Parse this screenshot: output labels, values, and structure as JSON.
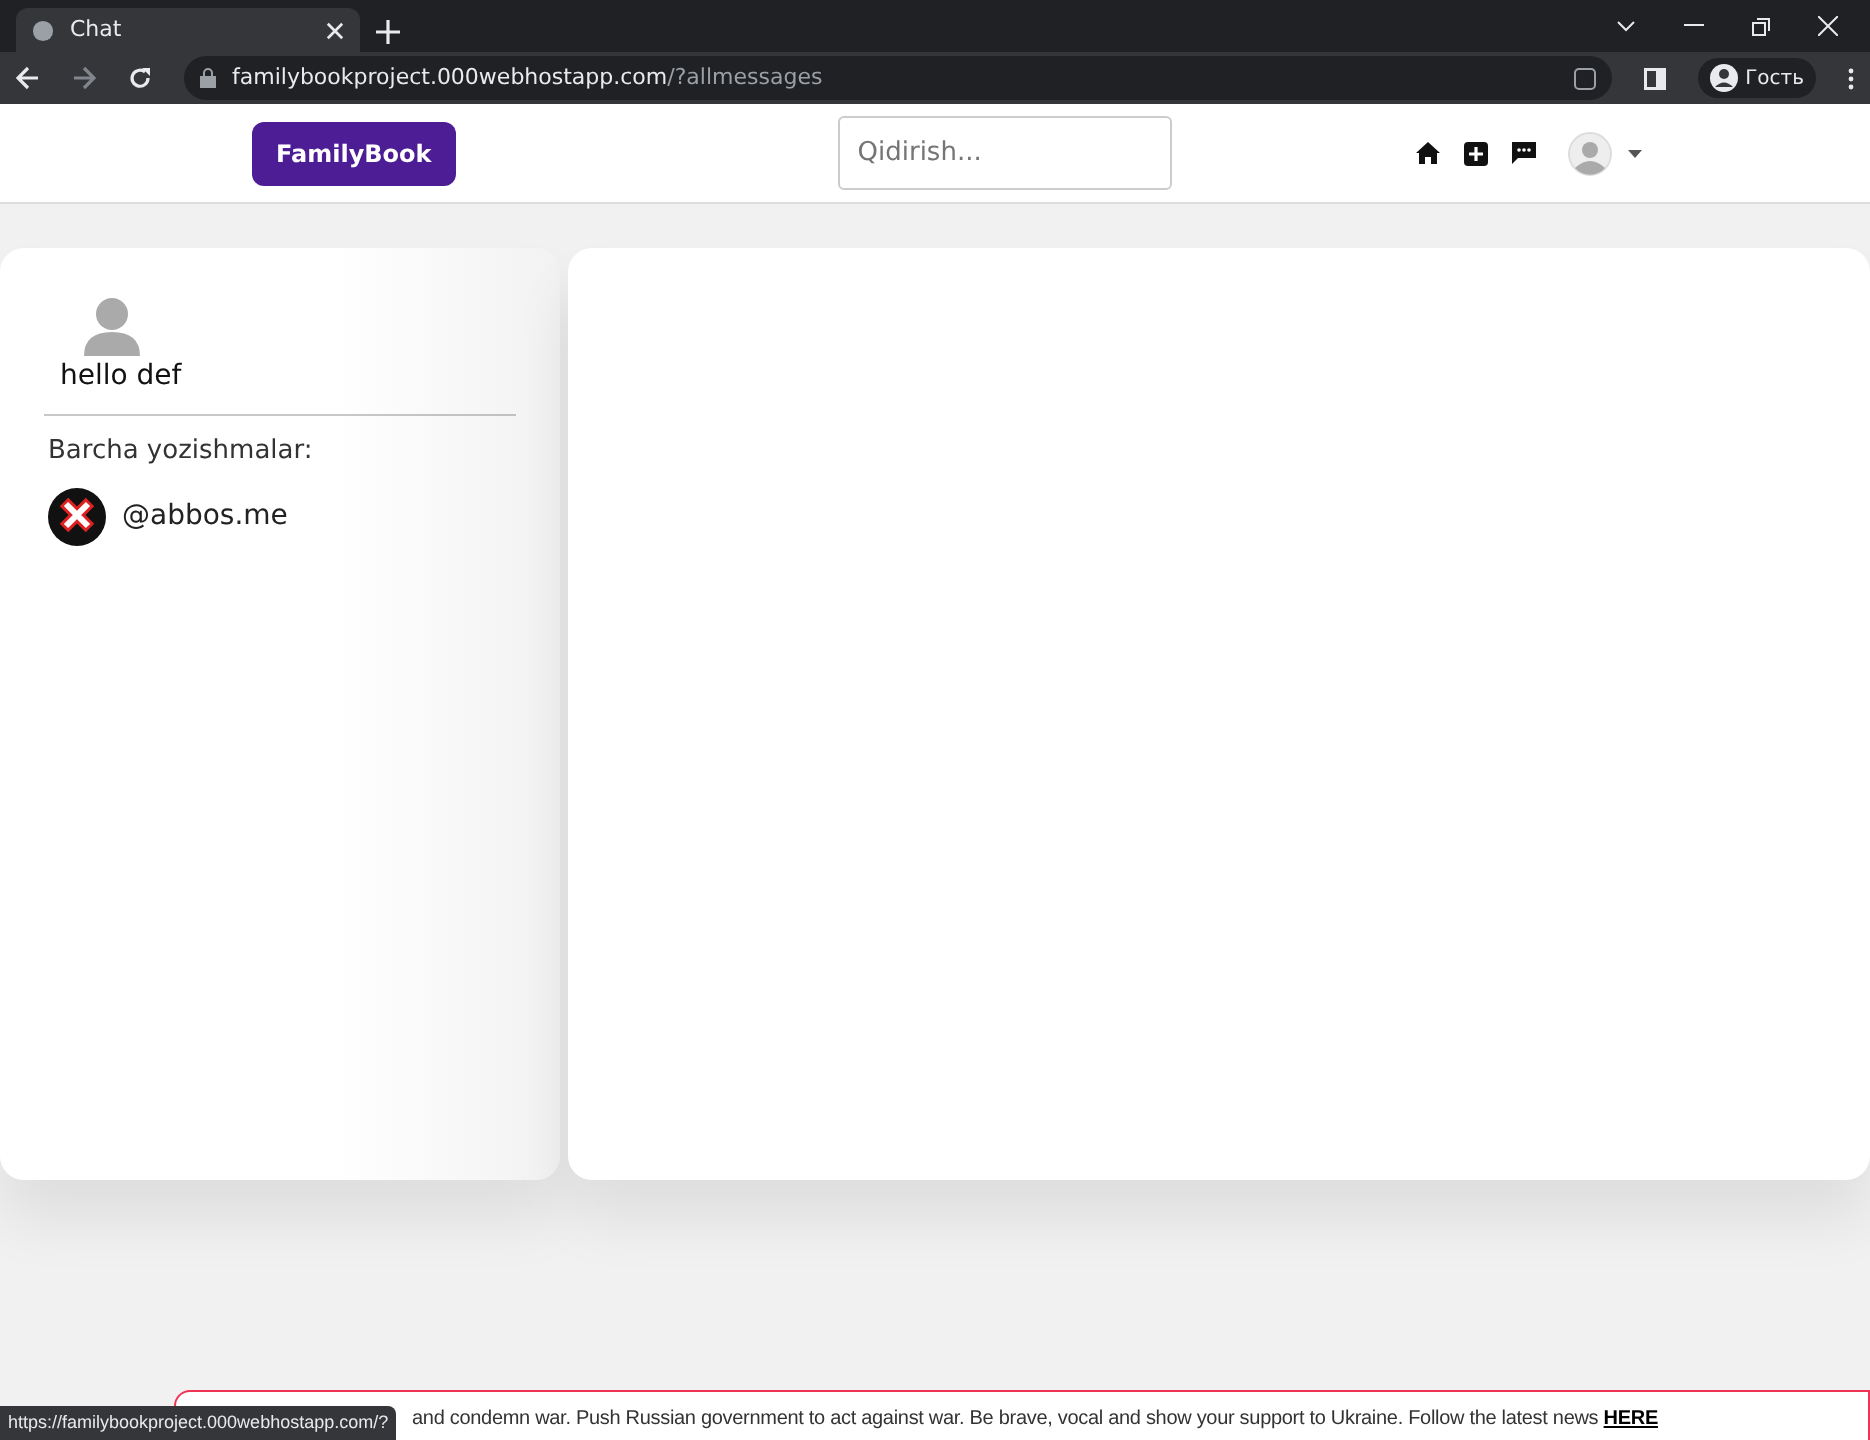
{
  "browser": {
    "tab_title": "Chat",
    "url_host": "familybookproject.000webhostapp.com",
    "url_path": "/?allmessages",
    "profile": "Гость"
  },
  "navbar": {
    "brand": "FamilyBook",
    "search": {
      "placeholder": "Qidirish..."
    }
  },
  "sidebar": {
    "user_name": "hello def",
    "section_label": "Barcha yozishmalar:",
    "conversations": [
      {
        "name": "@abbos.me"
      }
    ]
  },
  "banner": {
    "text": "and condemn war. Push Russian government to act against war. Be brave, vocal and show your support to Ukraine. Follow the latest news",
    "link": "HERE"
  },
  "status_url": "https://familybookproject.000webhostapp.com/?"
}
